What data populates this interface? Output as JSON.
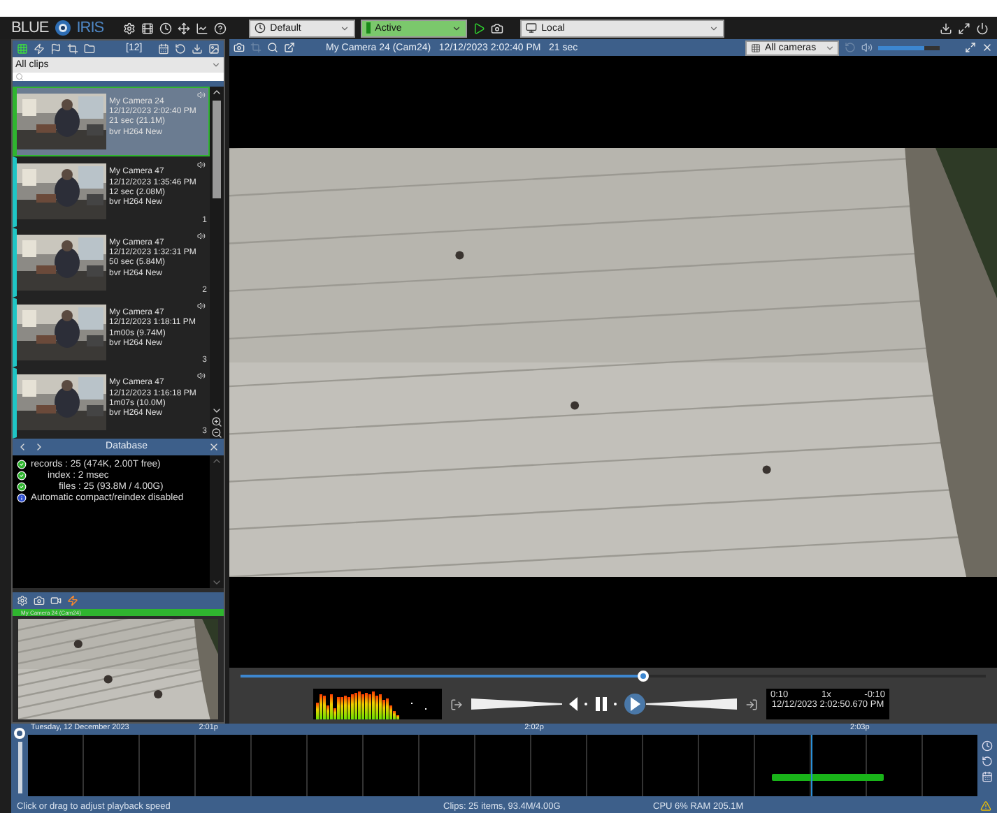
{
  "toolbar": {
    "logo_left": "BLUE",
    "logo_right": "IRIS",
    "profile_select": "Default",
    "schedule_select": "Active",
    "server_select": "Local"
  },
  "clips_panel": {
    "count": "[12]",
    "filter": "All clips",
    "clips": [
      {
        "camera": "My Camera 24",
        "time": "12/12/2023 2:02:40 PM",
        "length": "21 sec (21.1M)",
        "tags": "bvr H264 New",
        "selected": true
      },
      {
        "camera": "My Camera 47",
        "time": "12/12/2023 1:35:46 PM",
        "length": "12 sec (2.08M)",
        "tags": "bvr H264 New",
        "number": "1",
        "selected": false
      },
      {
        "camera": "My Camera 47",
        "time": "12/12/2023 1:32:31 PM",
        "length": "50 sec (5.84M)",
        "tags": "bvr H264 New",
        "number": "2",
        "selected": false
      },
      {
        "camera": "My Camera 47",
        "time": "12/12/2023 1:18:11 PM",
        "length": "1m00s (9.74M)",
        "tags": "bvr H264 New",
        "number": "3",
        "selected": false
      },
      {
        "camera": "My Camera 47",
        "time": "12/12/2023 1:16:18 PM",
        "length": "1m07s (10.0M)",
        "tags": "bvr H264 New",
        "number": "3",
        "selected": false
      }
    ]
  },
  "database_panel": {
    "title": "Database",
    "lines": [
      {
        "kind": "ok",
        "text": "records : 25 (474K, 2.00T free)"
      },
      {
        "kind": "ok",
        "text": "index : 2 msec"
      },
      {
        "kind": "ok",
        "text": "files : 25 (93.8M / 4.00G)"
      },
      {
        "kind": "info",
        "text": "Automatic compact/reindex disabled"
      }
    ]
  },
  "camera_panel": {
    "title": "My Camera 24 (Cam24)"
  },
  "viewer": {
    "title": "My Camera 24 (Cam24)   12/12/2023 2:02:40 PM   21 sec",
    "camera_filter": "All cameras",
    "volume": {
      "level": 0.75
    },
    "scrubber": {
      "level": 0.54
    }
  },
  "playback": {
    "elapsed": "0:10",
    "speed": "1x",
    "remaining": "-0:10",
    "position": "12/12/2023 2:02:50.670 PM"
  },
  "timeline": {
    "date": "Tuesday, 12 December 2023",
    "ticks": [
      "2:01p",
      "2:02p",
      "2:03p"
    ]
  },
  "status_bar": {
    "hint": "Click or drag to adjust playback speed",
    "clips": "Clips: 25 items, 93.4M/4.00G",
    "resources": "CPU 6% RAM 205.1M"
  }
}
